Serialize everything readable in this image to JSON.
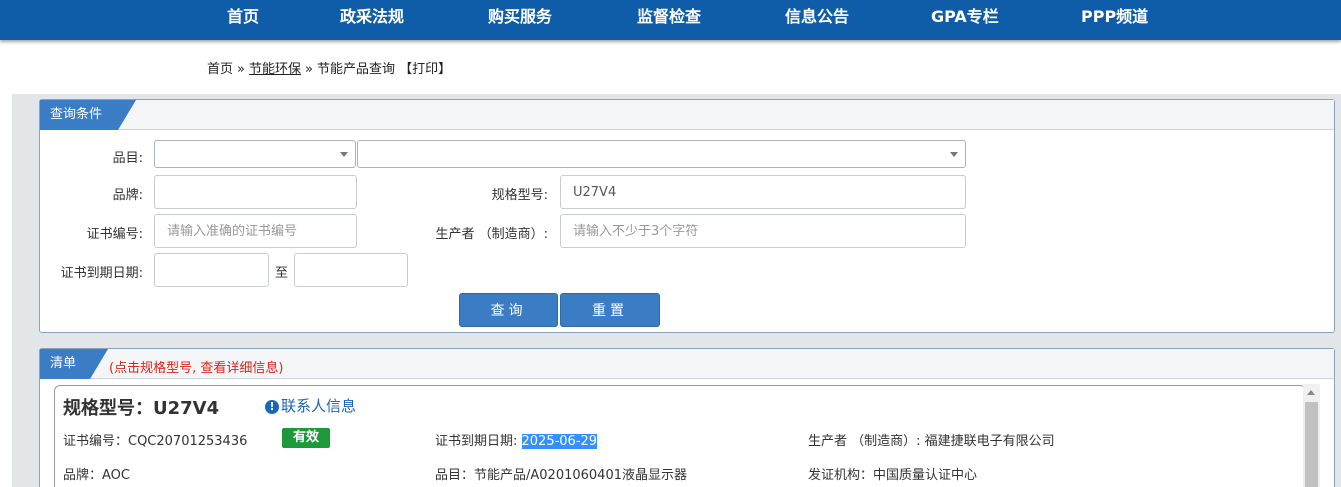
{
  "nav": {
    "items": [
      "首页",
      "政采法规",
      "购买服务",
      "监督检查",
      "信息公告",
      "GPA专栏",
      "PPP频道"
    ]
  },
  "breadcrumb": {
    "home": "首页",
    "sep": "»",
    "section": "节能环保",
    "current": "节能产品查询",
    "print": "【打印】"
  },
  "query": {
    "tab": "查询条件",
    "category_label": "品目:",
    "brand_label": "品牌:",
    "model_label": "规格型号:",
    "model_value": "U27V4",
    "cert_label": "证书编号:",
    "cert_placeholder": "请输入准确的证书编号",
    "maker_label": "生产者 （制造商）:",
    "maker_placeholder": "请输入不少于3个字符",
    "expiry_label": "证书到期日期:",
    "to_label": "至",
    "search_button": "查询",
    "reset_button": "重置"
  },
  "results": {
    "tab": "清单",
    "hint": "(点击规格型号, 查看详细信息)",
    "item": {
      "model_title": "规格型号：U27V4",
      "contact_link": "联系人信息",
      "cert_no": "证书编号：CQC20701253436",
      "status": "有效",
      "expiry_label": "证书到期日期: ",
      "expiry_value": "2025-06-29",
      "maker": "生产者 （制造商）: 福建捷联电子有限公司",
      "brand": "品牌：AOC",
      "category": "品目：节能产品/A0201060401液晶显示器",
      "issuer": "发证机构：中国质量认证中心"
    }
  }
}
